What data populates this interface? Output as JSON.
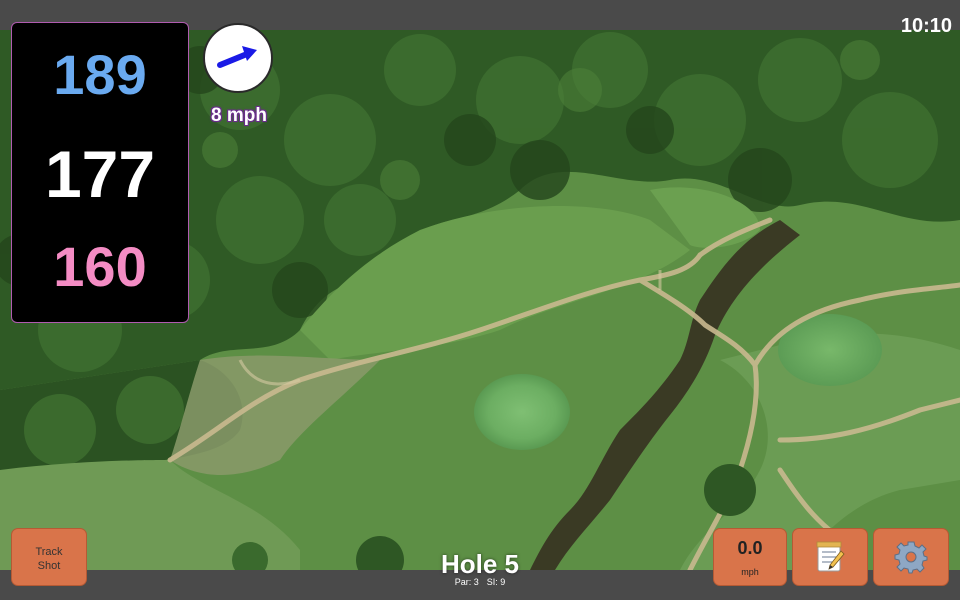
{
  "status": {
    "clock": "10:10"
  },
  "distances": {
    "back": "189",
    "middle": "177",
    "front": "160"
  },
  "wind": {
    "speed_label": "8 mph",
    "direction_icon": "arrow-icon"
  },
  "hole": {
    "title": "Hole 5",
    "par": "Par: 3",
    "stroke_index": "SI: 9"
  },
  "buttons": {
    "track_shot_line1": "Track",
    "track_shot_line2": "Shot",
    "wind_value": "0.0",
    "wind_unit": "mph",
    "notes_icon": "notepad-icon",
    "settings_icon": "gear-icon"
  },
  "colors": {
    "back": "#6aaaf0",
    "middle": "#ffffff",
    "front": "#f48cc4",
    "button": "#d9744a",
    "panel_border": "#b05bb0"
  }
}
